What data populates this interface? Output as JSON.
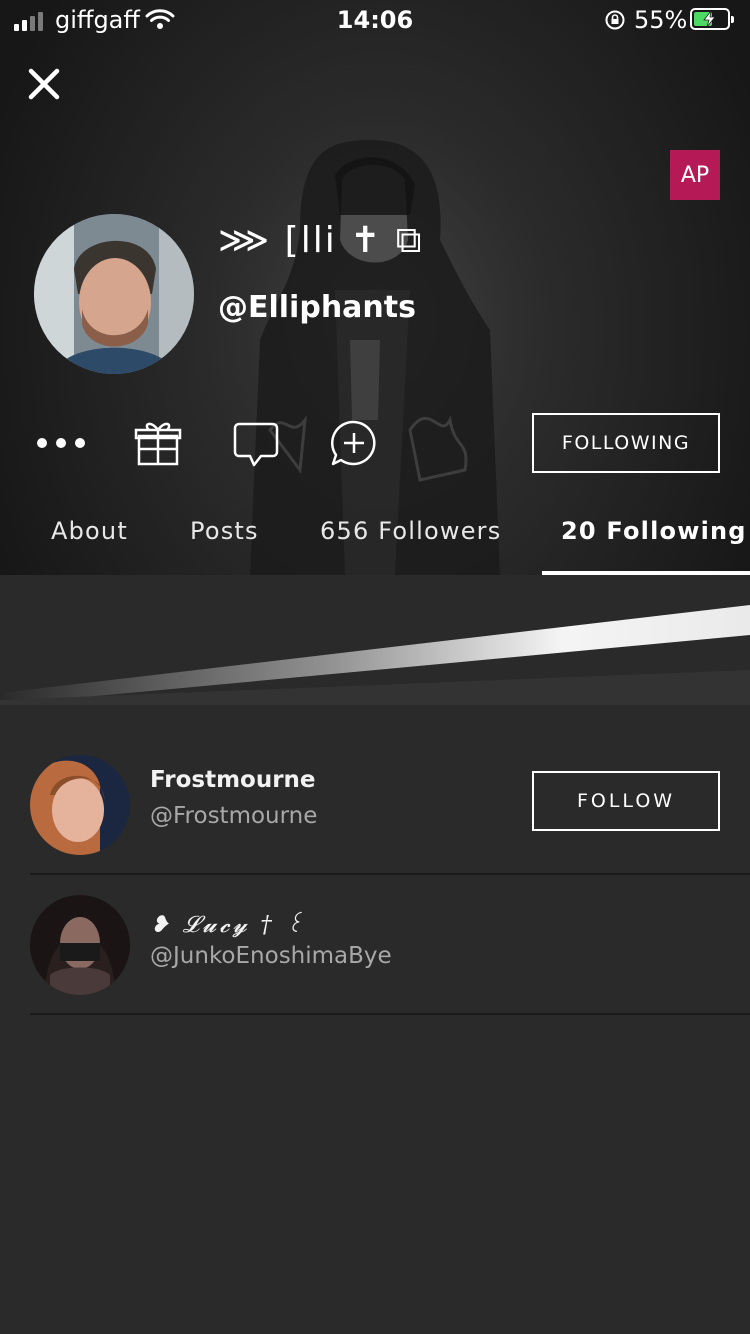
{
  "status_bar": {
    "carrier": "giffgaff",
    "time": "14:06",
    "battery_percent": "55%",
    "battery_level": 0.55,
    "icons": [
      "signal-icon",
      "wifi-icon",
      "orientation-lock-icon",
      "battery-charging-icon"
    ]
  },
  "header": {
    "close_icon": "close-icon",
    "badge": "AP",
    "display_name": "⋙ [lli ✝ ⧉",
    "username": "@Elliphants",
    "actions": [
      "more-icon",
      "gift-icon",
      "chat-icon",
      "add-chat-icon"
    ],
    "following_button": "FOLLOWING"
  },
  "tabs": [
    {
      "label": "About",
      "active": false
    },
    {
      "label": "Posts",
      "active": false
    },
    {
      "label": "656 Followers",
      "active": false
    },
    {
      "label": "20 Following",
      "active": true
    }
  ],
  "following_list": [
    {
      "name": "Frostmourne",
      "handle": "@Frostmourne",
      "button": "FOLLOW"
    },
    {
      "name": "❥ 𝓛𝓾𝓬𝔂 † ꒰",
      "handle": "@JunkoEnoshimaBye",
      "button": ""
    }
  ],
  "colors": {
    "background": "#2a2a2a",
    "badge": "#b51a56",
    "battery": "#4cd964"
  }
}
